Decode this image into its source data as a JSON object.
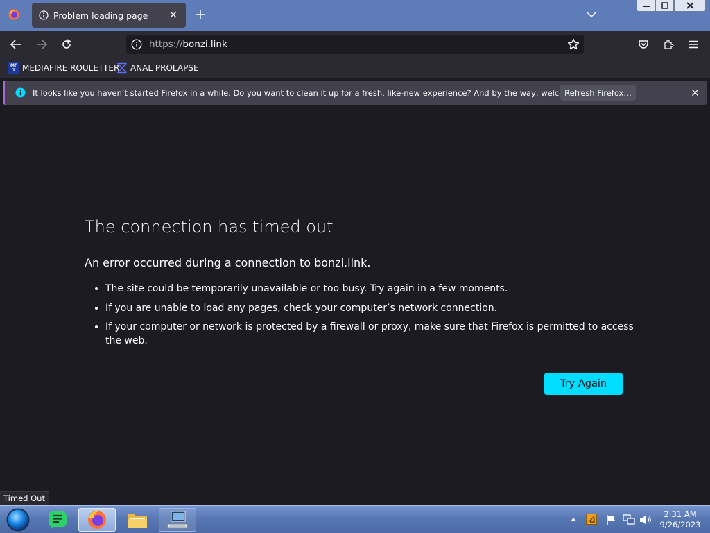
{
  "tab": {
    "title": "Problem loading page"
  },
  "urlbar": {
    "scheme": "https://",
    "host": "bonzi.link"
  },
  "bookmarks": [
    {
      "label": "MEDIAFIRE ROULETTER",
      "favicon_text": "MF T"
    },
    {
      "label": "ANAL PROLAPSE"
    }
  ],
  "notification": {
    "text": "It looks like you haven’t started Firefox in a while. Do you want to clean it up for a fresh, like-new experience? And by the way, welcome back!",
    "button_label": "Refresh Firefox…"
  },
  "error_page": {
    "title": "The connection has timed out",
    "description": "An error occurred during a connection to bonzi.link.",
    "bullets": [
      "The site could be temporarily unavailable or too busy. Try again in a few moments.",
      "If you are unable to load any pages, check your computer’s network connection.",
      "If your computer or network is protected by a firewall or proxy, make sure that Firefox is permitted to access the web."
    ],
    "button_label": "Try Again"
  },
  "status_panel": {
    "text": "Timed Out"
  },
  "taskbar": {
    "time": "2:31 AM",
    "date": "9/26/2023"
  },
  "colors": {
    "accent_cyan": "#00ddff",
    "page_bg": "#1c1b22",
    "toolbar_bg": "#2b2a33",
    "tabstrip_bg": "#5e7db8",
    "notification_border": "#a86bd3"
  },
  "icons": [
    "firefox-logo-icon",
    "info-icon",
    "close-icon",
    "plus-icon",
    "chevron-down-icon",
    "back-arrow-icon",
    "forward-arrow-icon",
    "reload-icon",
    "star-icon",
    "pocket-icon",
    "extensions-icon",
    "hamburger-menu-icon",
    "bookmark-favicon",
    "sigma-icon",
    "start-orb-icon",
    "chat-app-icon",
    "firefox-icon",
    "folder-icon",
    "keyboard-pc-icon",
    "show-hidden-icons",
    "flag-icon",
    "network-icon",
    "volume-icon"
  ]
}
